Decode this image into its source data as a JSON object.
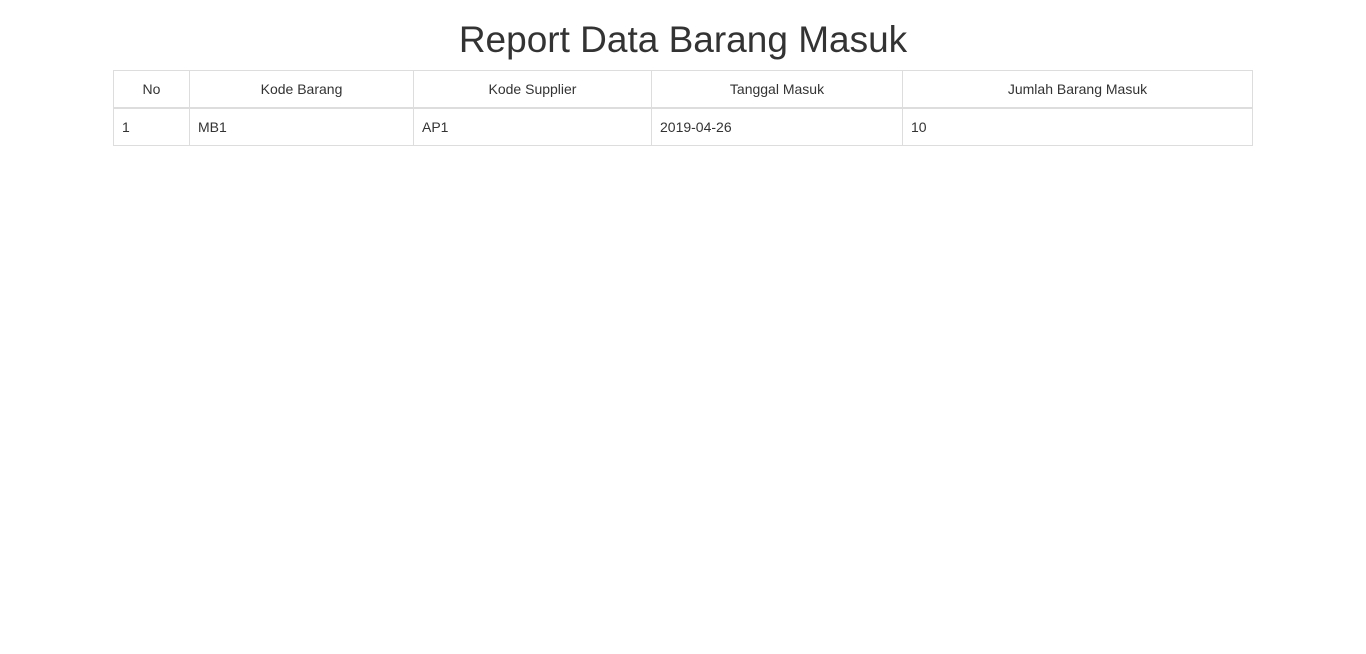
{
  "page": {
    "title": "Report Data Barang Masuk"
  },
  "table": {
    "headers": [
      "No",
      "Kode Barang",
      "Kode Supplier",
      "Tanggal Masuk",
      "Jumlah Barang Masuk"
    ],
    "rows": [
      [
        "1",
        "MB1",
        "AP1",
        "2019-04-26",
        "10"
      ]
    ]
  },
  "colors": {
    "text": "#333333",
    "border": "#dddddd",
    "background": "#ffffff"
  }
}
